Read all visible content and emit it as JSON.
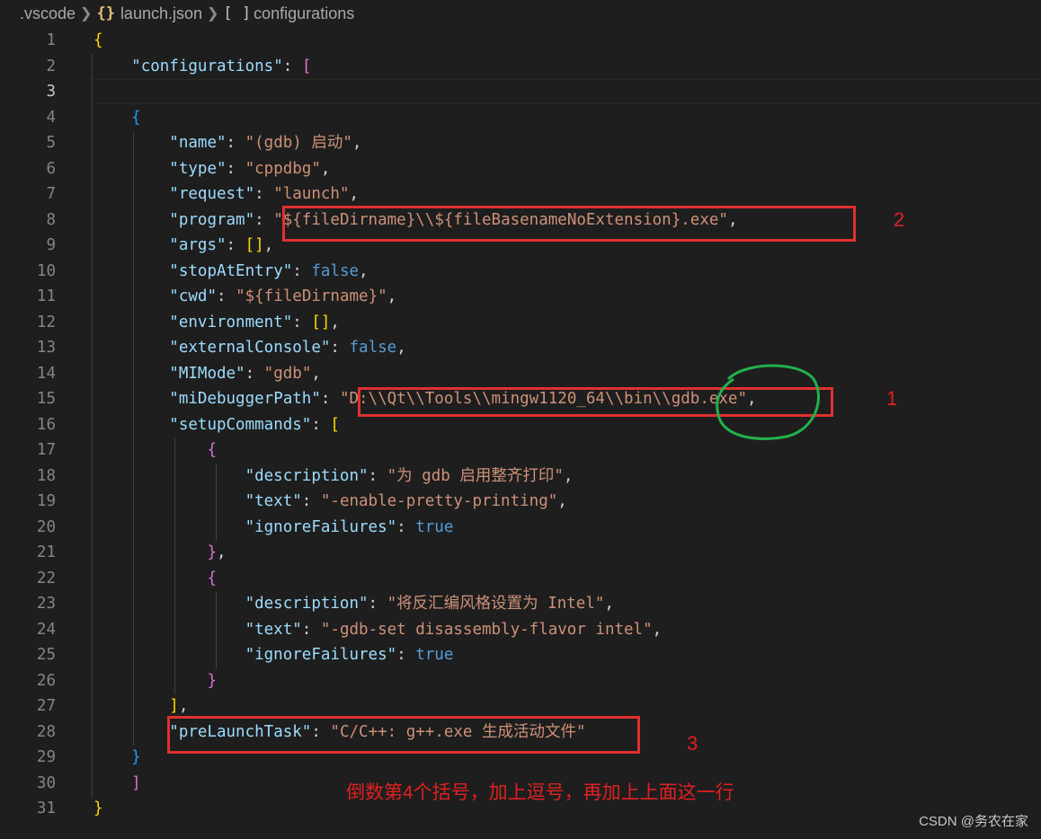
{
  "breadcrumb": {
    "folder": ".vscode",
    "file": "launch.json",
    "file_icon": "{}",
    "symbol": "configurations",
    "symbol_icon": "[ ]"
  },
  "editor": {
    "current_line": 3,
    "lines": [
      {
        "n": "1",
        "t": [
          [
            "{",
            "br1"
          ]
        ]
      },
      {
        "n": "2",
        "t": [
          [
            "    ",
            ""
          ],
          [
            "\"configurations\"",
            "k"
          ],
          [
            ": ",
            "p"
          ],
          [
            "[",
            "br2"
          ]
        ]
      },
      {
        "n": "3",
        "t": []
      },
      {
        "n": "4",
        "t": [
          [
            "    {",
            "br3"
          ]
        ]
      },
      {
        "n": "5",
        "t": [
          [
            "        ",
            ""
          ],
          [
            "\"name\"",
            "k"
          ],
          [
            ": ",
            "p"
          ],
          [
            "\"(gdb) 启动\"",
            "s"
          ],
          [
            ",",
            "p"
          ]
        ]
      },
      {
        "n": "6",
        "t": [
          [
            "        ",
            ""
          ],
          [
            "\"type\"",
            "k"
          ],
          [
            ": ",
            "p"
          ],
          [
            "\"cppdbg\"",
            "s"
          ],
          [
            ",",
            "p"
          ]
        ]
      },
      {
        "n": "7",
        "t": [
          [
            "        ",
            ""
          ],
          [
            "\"request\"",
            "k"
          ],
          [
            ": ",
            "p"
          ],
          [
            "\"launch\"",
            "s"
          ],
          [
            ",",
            "p"
          ]
        ]
      },
      {
        "n": "8",
        "t": [
          [
            "        ",
            ""
          ],
          [
            "\"program\"",
            "k"
          ],
          [
            ": ",
            "p"
          ],
          [
            "\"${fileDirname}\\\\${fileBasenameNoExtension}.exe\"",
            "s"
          ],
          [
            ",",
            "p"
          ]
        ]
      },
      {
        "n": "9",
        "t": [
          [
            "        ",
            ""
          ],
          [
            "\"args\"",
            "k"
          ],
          [
            ": ",
            "p"
          ],
          [
            "[]",
            "br1"
          ],
          [
            ",",
            "p"
          ]
        ]
      },
      {
        "n": "10",
        "t": [
          [
            "        ",
            ""
          ],
          [
            "\"stopAtEntry\"",
            "k"
          ],
          [
            ": ",
            "p"
          ],
          [
            "false",
            "b"
          ],
          [
            ",",
            "p"
          ]
        ]
      },
      {
        "n": "11",
        "t": [
          [
            "        ",
            ""
          ],
          [
            "\"cwd\"",
            "k"
          ],
          [
            ": ",
            "p"
          ],
          [
            "\"${fileDirname}\"",
            "s"
          ],
          [
            ",",
            "p"
          ]
        ]
      },
      {
        "n": "12",
        "t": [
          [
            "        ",
            ""
          ],
          [
            "\"environment\"",
            "k"
          ],
          [
            ": ",
            "p"
          ],
          [
            "[]",
            "br1"
          ],
          [
            ",",
            "p"
          ]
        ]
      },
      {
        "n": "13",
        "t": [
          [
            "        ",
            ""
          ],
          [
            "\"externalConsole\"",
            "k"
          ],
          [
            ": ",
            "p"
          ],
          [
            "false",
            "b"
          ],
          [
            ",",
            "p"
          ]
        ]
      },
      {
        "n": "14",
        "t": [
          [
            "        ",
            ""
          ],
          [
            "\"MIMode\"",
            "k"
          ],
          [
            ": ",
            "p"
          ],
          [
            "\"gdb\"",
            "s"
          ],
          [
            ",",
            "p"
          ]
        ]
      },
      {
        "n": "15",
        "t": [
          [
            "        ",
            ""
          ],
          [
            "\"miDebuggerPath\"",
            "k"
          ],
          [
            ": ",
            "p"
          ],
          [
            "\"D:\\\\Qt\\\\Tools\\\\mingw1120_64\\\\bin\\\\gdb.exe\"",
            "s"
          ],
          [
            ",",
            "p"
          ]
        ]
      },
      {
        "n": "16",
        "t": [
          [
            "        ",
            ""
          ],
          [
            "\"setupCommands\"",
            "k"
          ],
          [
            ": ",
            "p"
          ],
          [
            "[",
            "br1"
          ]
        ]
      },
      {
        "n": "17",
        "t": [
          [
            "            ",
            ""
          ],
          [
            "{",
            "br2"
          ]
        ]
      },
      {
        "n": "18",
        "t": [
          [
            "                ",
            ""
          ],
          [
            "\"description\"",
            "k"
          ],
          [
            ": ",
            "p"
          ],
          [
            "\"为 gdb 启用整齐打印\"",
            "s"
          ],
          [
            ",",
            "p"
          ]
        ]
      },
      {
        "n": "19",
        "t": [
          [
            "                ",
            ""
          ],
          [
            "\"text\"",
            "k"
          ],
          [
            ": ",
            "p"
          ],
          [
            "\"-enable-pretty-printing\"",
            "s"
          ],
          [
            ",",
            "p"
          ]
        ]
      },
      {
        "n": "20",
        "t": [
          [
            "                ",
            ""
          ],
          [
            "\"ignoreFailures\"",
            "k"
          ],
          [
            ": ",
            "p"
          ],
          [
            "true",
            "b"
          ]
        ]
      },
      {
        "n": "21",
        "t": [
          [
            "            ",
            ""
          ],
          [
            "}",
            "br2"
          ],
          [
            ",",
            "p"
          ]
        ]
      },
      {
        "n": "22",
        "t": [
          [
            "            ",
            ""
          ],
          [
            "{",
            "br2"
          ]
        ]
      },
      {
        "n": "23",
        "t": [
          [
            "                ",
            ""
          ],
          [
            "\"description\"",
            "k"
          ],
          [
            ": ",
            "p"
          ],
          [
            "\"将反汇编风格设置为 Intel\"",
            "s"
          ],
          [
            ",",
            "p"
          ]
        ]
      },
      {
        "n": "24",
        "t": [
          [
            "                ",
            ""
          ],
          [
            "\"text\"",
            "k"
          ],
          [
            ": ",
            "p"
          ],
          [
            "\"-gdb-set disassembly-flavor intel\"",
            "s"
          ],
          [
            ",",
            "p"
          ]
        ]
      },
      {
        "n": "25",
        "t": [
          [
            "                ",
            ""
          ],
          [
            "\"ignoreFailures\"",
            "k"
          ],
          [
            ": ",
            "p"
          ],
          [
            "true",
            "b"
          ]
        ]
      },
      {
        "n": "26",
        "t": [
          [
            "            ",
            ""
          ],
          [
            "}",
            "br2"
          ]
        ]
      },
      {
        "n": "27",
        "t": [
          [
            "        ",
            ""
          ],
          [
            "]",
            "br1"
          ],
          [
            ",",
            "p"
          ]
        ]
      },
      {
        "n": "28",
        "t": [
          [
            "        ",
            ""
          ],
          [
            "\"preLaunchTask\"",
            "k"
          ],
          [
            ": ",
            "p"
          ],
          [
            "\"C/C++: g++.exe 生成活动文件\"",
            "s"
          ]
        ]
      },
      {
        "n": "29",
        "t": [
          [
            "    }",
            "br3"
          ]
        ]
      },
      {
        "n": "30",
        "t": [
          [
            "    ]",
            "br2"
          ]
        ]
      },
      {
        "n": "31",
        "t": [
          [
            "}",
            "br1"
          ]
        ]
      }
    ]
  },
  "annotations": {
    "marker_1": "1",
    "marker_2": "2",
    "marker_3": "3",
    "note": "倒数第4个括号，加上逗号，再加上上面这一行"
  },
  "watermark": "CSDN @务农在家",
  "colors": {
    "background": "#1e1e1e",
    "key": "#9cdcfe",
    "string": "#ce9178",
    "boolean": "#569cd6",
    "annotation_red": "#e03030",
    "annotation_green": "#22b14c"
  }
}
